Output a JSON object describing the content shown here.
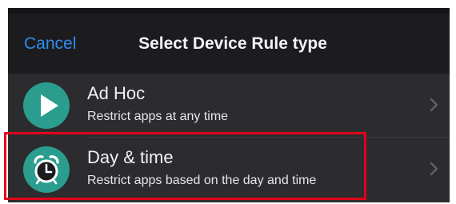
{
  "header": {
    "cancel_label": "Cancel",
    "title": "Select Device Rule type"
  },
  "rules": [
    {
      "title": "Ad Hoc",
      "subtitle": "Restrict apps at any time",
      "icon": "play-icon"
    },
    {
      "title": "Day & time",
      "subtitle": "Restrict apps based on the day and time",
      "icon": "alarm-clock-icon"
    }
  ],
  "colors": {
    "background": "#1c1c1e",
    "list_background": "#2c2c2e",
    "accent": "#2f8cf0",
    "icon_background": "#2a9d8f",
    "highlight": "#e0001b"
  }
}
